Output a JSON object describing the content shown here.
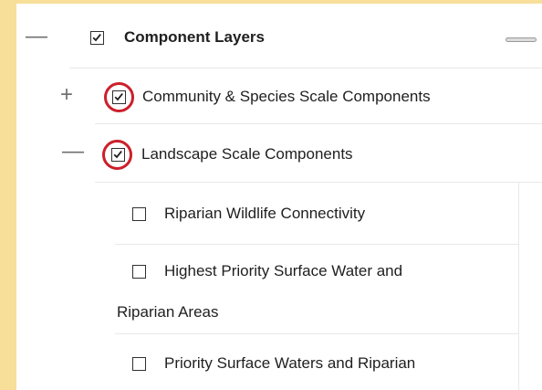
{
  "layer_tree": {
    "root": {
      "toggle": "—",
      "label": "Component Layers",
      "checked": true
    },
    "items": [
      {
        "toggle": "+",
        "label": "Community & Species Scale Components",
        "checked": true,
        "highlighted": true
      },
      {
        "toggle": "—",
        "label": "Landscape Scale Components",
        "checked": true,
        "highlighted": true
      }
    ],
    "sublayers": [
      {
        "label": "Riparian Wildlife Connectivity",
        "checked": false
      },
      {
        "label_line1": "Highest Priority Surface Water and",
        "label_line2": "Riparian Areas",
        "checked": false
      },
      {
        "label": "Priority Surface Waters and Riparian",
        "checked": false
      }
    ]
  },
  "colors": {
    "background": "#f7de99",
    "highlight_ring": "#cc1f2b"
  }
}
